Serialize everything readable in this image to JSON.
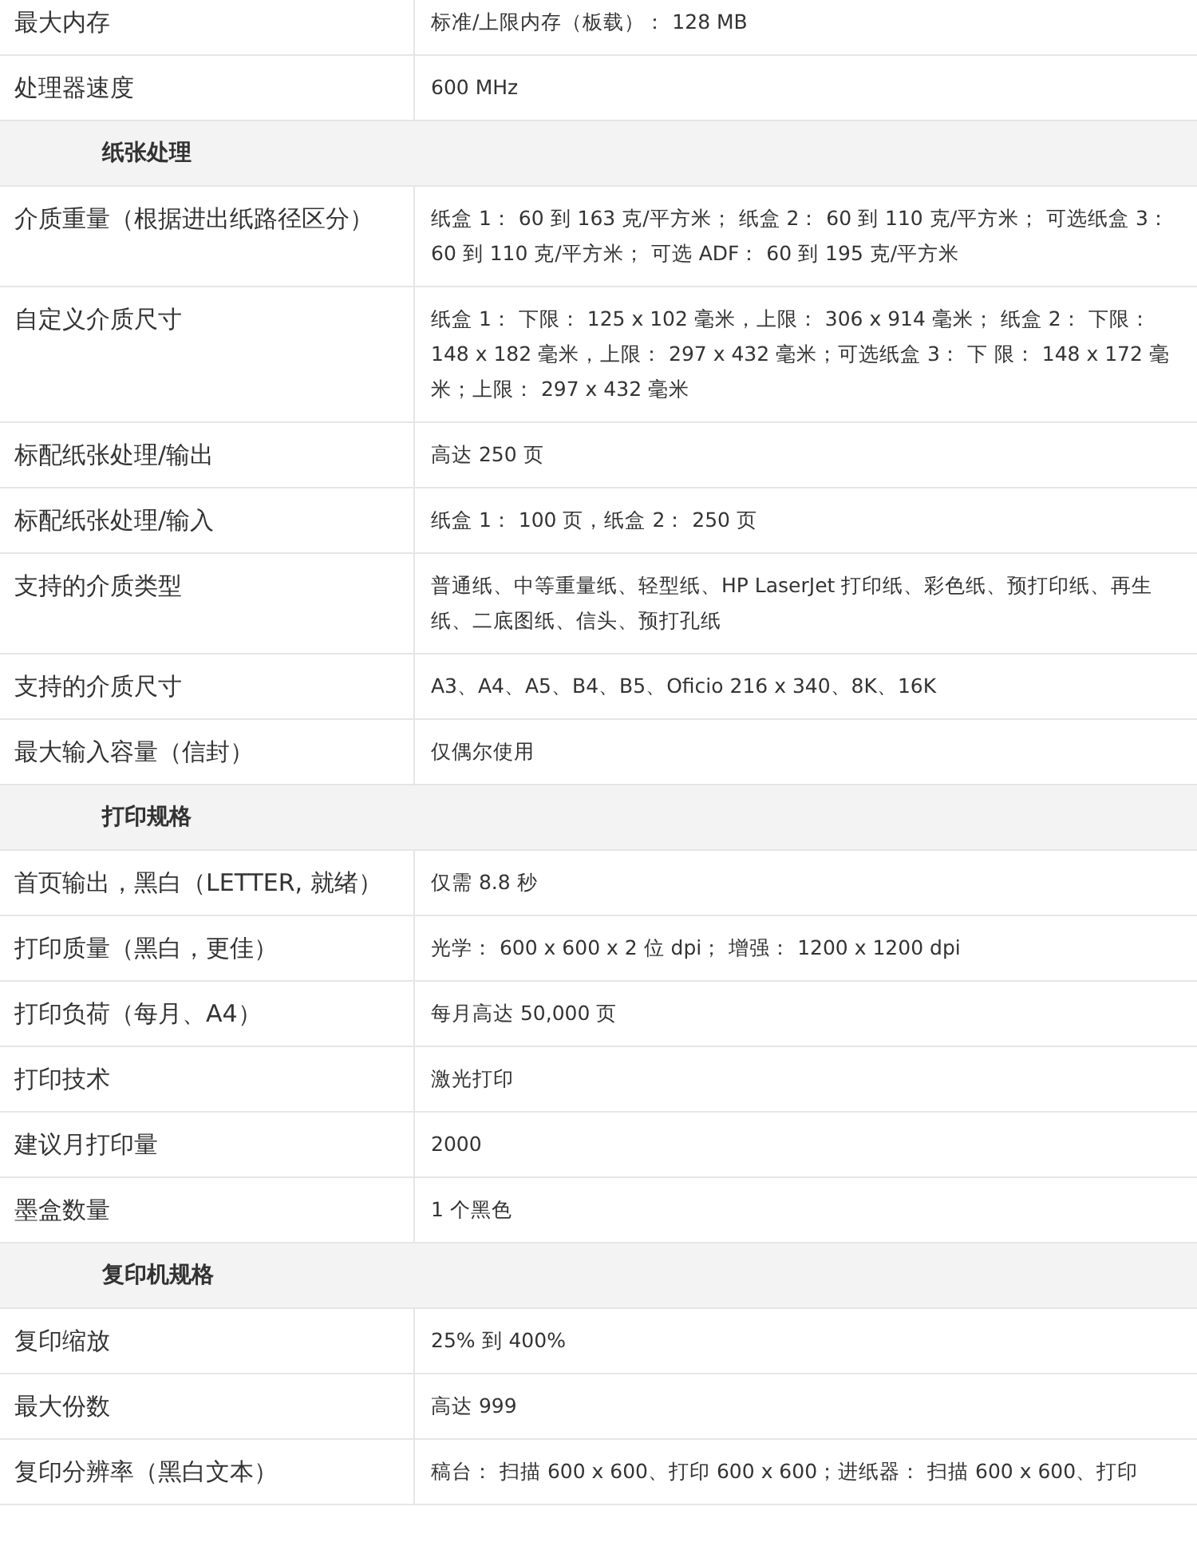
{
  "rows": [
    {
      "kind": "spec",
      "label": "最大内存",
      "value": "标准/上限内存（板载）： 128 MB"
    },
    {
      "kind": "spec",
      "label": "处理器速度",
      "value": "600 MHz"
    },
    {
      "kind": "section",
      "title": "纸张处理"
    },
    {
      "kind": "spec",
      "label": "介质重量（根据进出纸路径区分）",
      "value": "纸盒 1： 60 到 163 克/平方米； 纸盒 2： 60 到 110 克/平方米； 可选纸盒 3： 60 到 110 克/平方米； 可选 ADF： 60 到 195 克/平方米"
    },
    {
      "kind": "spec",
      "label": "自定义介质尺寸",
      "value": "纸盒 1： 下限： 125 x 102 毫米，上限： 306 x 914 毫米； 纸盒 2： 下限： 148 x 182 毫米，上限： 297 x 432 毫米；可选纸盒 3： 下 限： 148 x 172 毫米；上限： 297 x 432 毫米"
    },
    {
      "kind": "spec",
      "label": "标配纸张处理/输出",
      "value": "高达 250 页"
    },
    {
      "kind": "spec",
      "label": "标配纸张处理/输入",
      "value": "纸盒 1： 100 页，纸盒 2： 250 页"
    },
    {
      "kind": "spec",
      "label": "支持的介质类型",
      "value": "普通纸、中等重量纸、轻型纸、HP LaserJet 打印纸、彩色纸、预打印纸、再生纸、二底图纸、信头、预打孔纸"
    },
    {
      "kind": "spec",
      "label": "支持的介质尺寸",
      "value": "A3、A4、A5、B4、B5、Oficio 216 x 340、8K、16K"
    },
    {
      "kind": "spec",
      "label": "最大输入容量（信封）",
      "value": "仅偶尔使用"
    },
    {
      "kind": "section",
      "title": "打印规格"
    },
    {
      "kind": "spec",
      "label": "首页输出，黑白（LETTER, 就绪）",
      "value": "仅需 8.8 秒"
    },
    {
      "kind": "spec",
      "label": "打印质量（黑白，更佳）",
      "value": "光学： 600 x 600 x 2 位 dpi； 增强： 1200 x 1200 dpi"
    },
    {
      "kind": "spec",
      "label": "打印负荷（每月、A4）",
      "value": "每月高达 50,000 页"
    },
    {
      "kind": "spec",
      "label": "打印技术",
      "value": "激光打印"
    },
    {
      "kind": "spec",
      "label": "建议月打印量",
      "value": "2000"
    },
    {
      "kind": "spec",
      "label": "墨盒数量",
      "value": "1 个黑色"
    },
    {
      "kind": "section",
      "title": "复印机规格"
    },
    {
      "kind": "spec",
      "label": "复印缩放",
      "value": "25% 到 400%"
    },
    {
      "kind": "spec",
      "label": "最大份数",
      "value": "高达 999"
    },
    {
      "kind": "spec",
      "label": "复印分辨率（黑白文本）",
      "value": "稿台： 扫描 600 x 600、打印 600 x 600；进纸器： 扫描 600 x 600、打印"
    }
  ]
}
